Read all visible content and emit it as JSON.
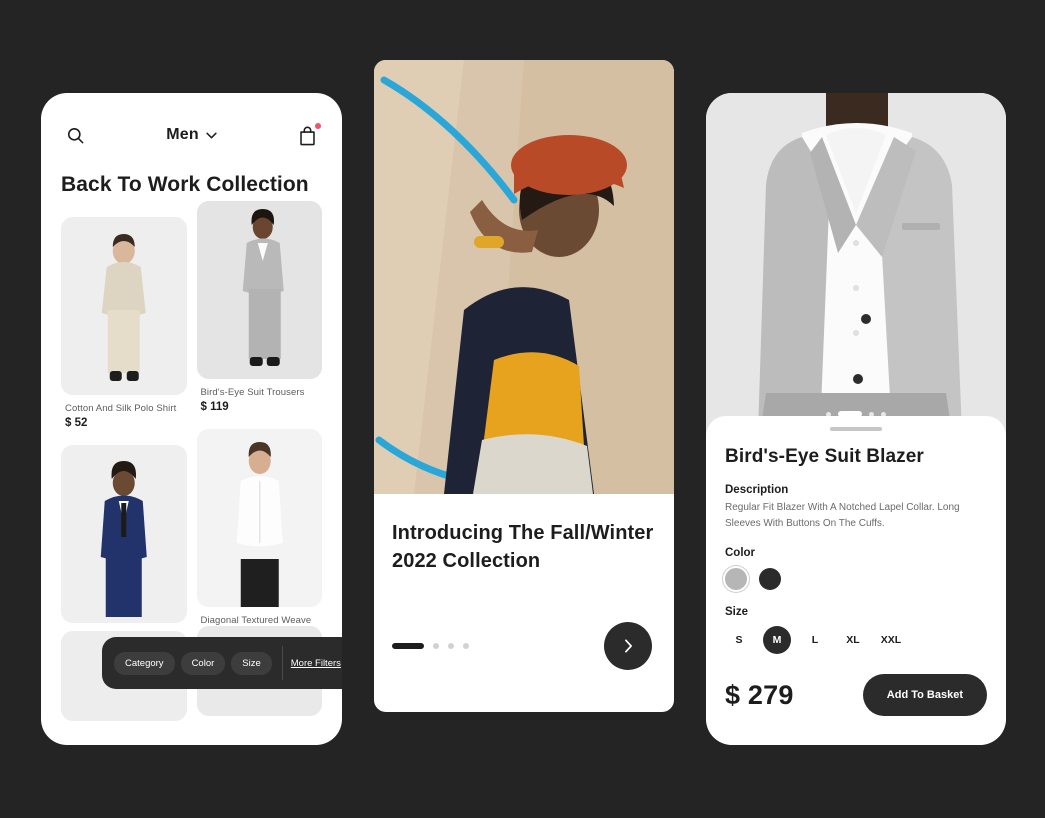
{
  "background_color": "#242424",
  "accent_dark": "#2b2b2b",
  "left_phone": {
    "header": {
      "search_icon": "search-icon",
      "category_label": "Men",
      "chevron_icon": "chevron-down-icon",
      "cart_icon": "shopping-bag-icon",
      "cart_has_badge": true,
      "badge_color": "#f2526b"
    },
    "title": "Back To Work Collection",
    "products": [
      {
        "name": "Cotton And Silk Polo Shirt",
        "price": "$ 52"
      },
      {
        "name": "Bird's-Eye Suit Trousers",
        "price": "$ 119"
      },
      {
        "name": "",
        "price": ""
      },
      {
        "name": "Diagonal Textured Weave",
        "price": ""
      }
    ],
    "filter_bar": {
      "chips": [
        "Category",
        "Color",
        "Size"
      ],
      "more_filters_label": "More Filters"
    }
  },
  "center_phone": {
    "headline": "Introducing The Fall/Winter 2022 Collection",
    "pagination": {
      "total": 4,
      "active_index": 0
    },
    "next_icon": "chevron-right-icon"
  },
  "right_phone": {
    "gallery": {
      "total": 4,
      "active_index": 1
    },
    "drag_handle": "drag-handle",
    "product_title": "Bird's-Eye Suit Blazer",
    "description_label": "Description",
    "description": "Regular Fit Blazer With A Notched Lapel Collar. Long Sleeves With Buttons On The Cuffs.",
    "color_label": "Color",
    "colors": [
      {
        "name": "gray",
        "hex": "#b6b6b6",
        "selected": true
      },
      {
        "name": "black",
        "hex": "#2b2b2b",
        "selected": false
      }
    ],
    "size_label": "Size",
    "sizes": [
      {
        "label": "S",
        "selected": false
      },
      {
        "label": "M",
        "selected": true
      },
      {
        "label": "L",
        "selected": false
      },
      {
        "label": "XL",
        "selected": false
      },
      {
        "label": "XXL",
        "selected": false
      }
    ],
    "price": "$ 279",
    "add_to_basket_label": "Add To Basket"
  }
}
